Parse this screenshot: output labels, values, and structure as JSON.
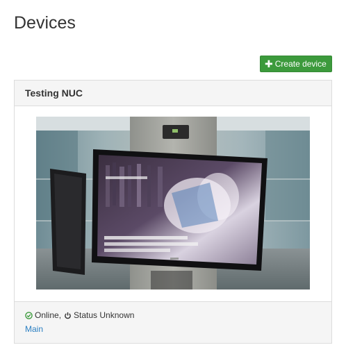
{
  "page": {
    "title": "Devices"
  },
  "toolbar": {
    "create_label": "Create device",
    "create_icon": "plus-icon",
    "accent_color": "#3c9a3c"
  },
  "devices": [
    {
      "name": "Testing NUC",
      "image_alt": "Screenshot of device display",
      "status": {
        "connection": "Online",
        "connection_icon": "check-circle-icon",
        "connection_color": "#3c9a3c",
        "separator": ",",
        "power_icon": "power-icon",
        "power": "Status Unknown"
      },
      "playlist": "Main"
    }
  ]
}
